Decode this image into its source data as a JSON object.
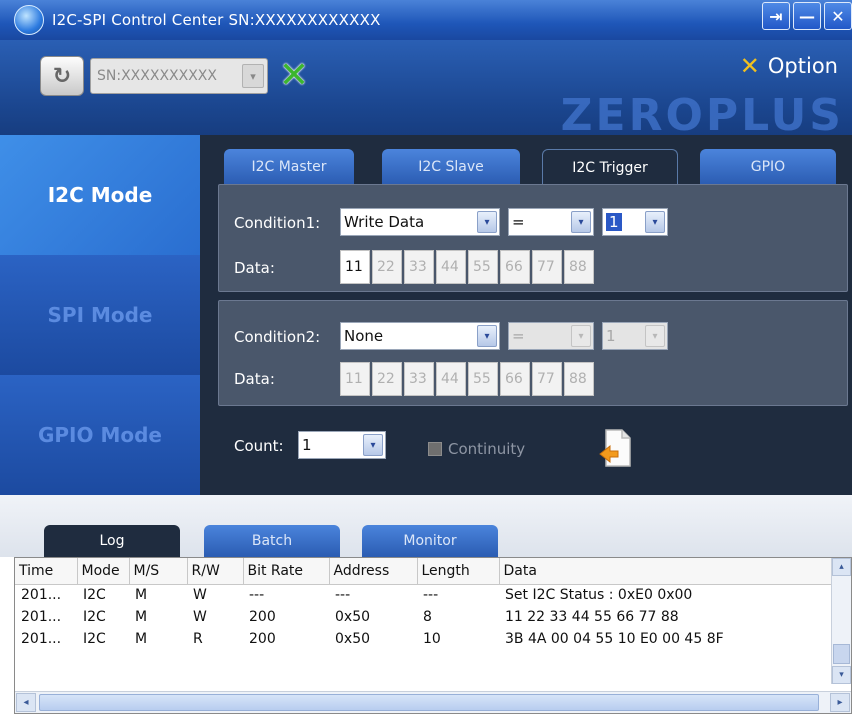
{
  "window": {
    "title": "I2C-SPI Control Center SN:XXXXXXXXXXXX",
    "pin_glyph": "⇥",
    "minimize_glyph": "—",
    "close_glyph": "✕"
  },
  "header": {
    "refresh_icon": "refresh-icon",
    "refresh_glyph": "↻",
    "sn_value": "SN:XXXXXXXXXX",
    "connect_glyph": "✕",
    "option_label": "Option",
    "option_glyph": "✕",
    "brand": "ZEROPLUS"
  },
  "modes": [
    {
      "label": "I2C Mode"
    },
    {
      "label": "SPI Mode"
    },
    {
      "label": "GPIO Mode"
    }
  ],
  "tabs": [
    {
      "label": "I2C Master"
    },
    {
      "label": "I2C Slave"
    },
    {
      "label": "I2C Trigger"
    },
    {
      "label": "GPIO"
    }
  ],
  "condition1": {
    "label": "Condition1:",
    "type": "Write Data",
    "operator": "=",
    "count": "1",
    "data_label": "Data:",
    "data": [
      "11",
      "22",
      "33",
      "44",
      "55",
      "66",
      "77",
      "88"
    ]
  },
  "condition2": {
    "label": "Condition2:",
    "type": "None",
    "operator": "=",
    "count": "1",
    "data_label": "Data:",
    "data": [
      "11",
      "22",
      "33",
      "44",
      "55",
      "66",
      "77",
      "88"
    ]
  },
  "count": {
    "label": "Count:",
    "value": "1"
  },
  "continuity": {
    "label": "Continuity"
  },
  "arrow_glyph": "▾",
  "scroll_up_glyph": "▴",
  "scroll_left_glyph": "◂",
  "scroll_right_glyph": "▸",
  "bottom_tabs": [
    {
      "label": "Log"
    },
    {
      "label": "Batch"
    },
    {
      "label": "Monitor"
    }
  ],
  "log": {
    "columns": [
      "Time",
      "Mode",
      "M/S",
      "R/W",
      "Bit Rate",
      "Address",
      "Length",
      "Data"
    ],
    "rows": [
      [
        "201...",
        "I2C",
        "M",
        "W",
        "---",
        "---",
        "---",
        "Set I2C Status : 0xE0 0x00"
      ],
      [
        "201...",
        "I2C",
        "M",
        "W",
        "200",
        "0x50",
        "8",
        "11 22 33 44 55 66 77 88"
      ],
      [
        "201...",
        "I2C",
        "M",
        "R",
        "200",
        "0x50",
        "10",
        "3B 4A 00 04 55 10 E0 00 45 8F"
      ]
    ]
  },
  "colors": {
    "title_bar": "#1e56b8",
    "panel_bg": "#1f2c3f",
    "condition_bg": "#4a576b",
    "active_mode": "#3f8fe8",
    "connect_green": "#3cb62f"
  }
}
